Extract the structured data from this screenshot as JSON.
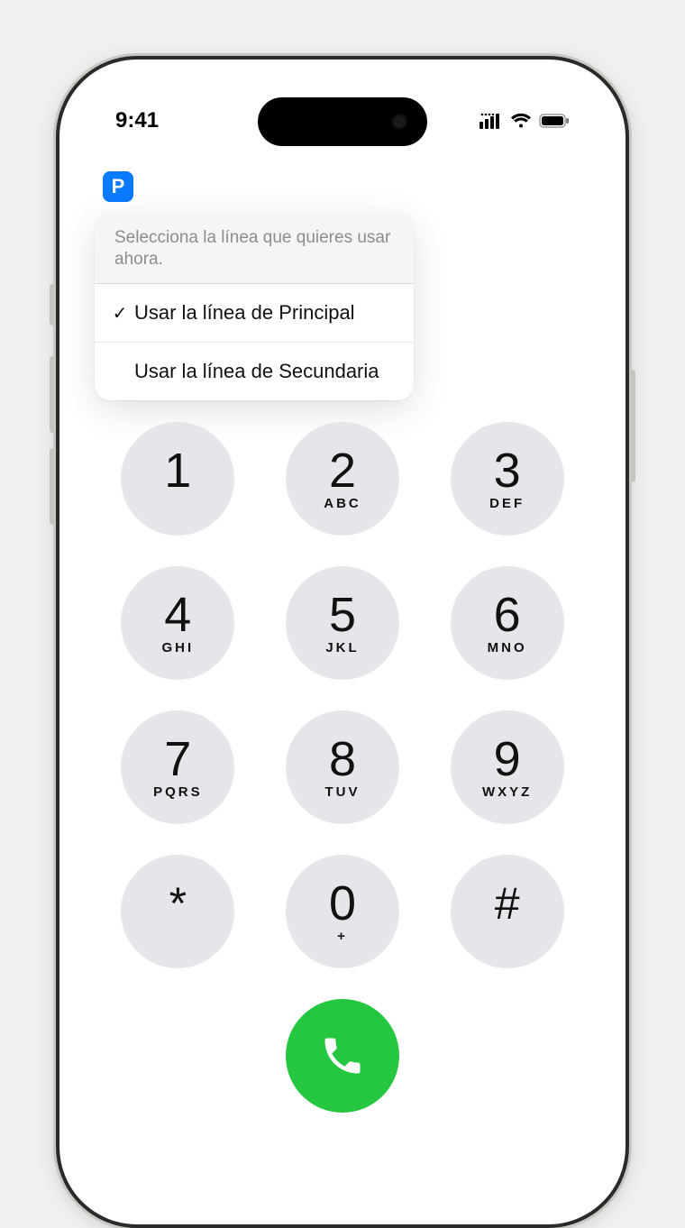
{
  "status": {
    "time": "9:41"
  },
  "line_badge": {
    "letter": "P",
    "color": "#0a7aff"
  },
  "popover": {
    "header": "Selecciona la línea que quieres usar ahora.",
    "options": [
      {
        "label": "Usar la línea de Principal",
        "selected": true
      },
      {
        "label": "Usar la línea de Secundaria",
        "selected": false
      }
    ]
  },
  "keypad": {
    "keys": [
      {
        "digit": "1",
        "letters": ""
      },
      {
        "digit": "2",
        "letters": "ABC"
      },
      {
        "digit": "3",
        "letters": "DEF"
      },
      {
        "digit": "4",
        "letters": "GHI"
      },
      {
        "digit": "5",
        "letters": "JKL"
      },
      {
        "digit": "6",
        "letters": "MNO"
      },
      {
        "digit": "7",
        "letters": "PQRS"
      },
      {
        "digit": "8",
        "letters": "TUV"
      },
      {
        "digit": "9",
        "letters": "WXYZ"
      },
      {
        "digit": "*",
        "letters": ""
      },
      {
        "digit": "0",
        "letters": "+"
      },
      {
        "digit": "#",
        "letters": ""
      }
    ]
  },
  "colors": {
    "key_bg": "#e6e5e9",
    "call_green": "#26c740"
  }
}
